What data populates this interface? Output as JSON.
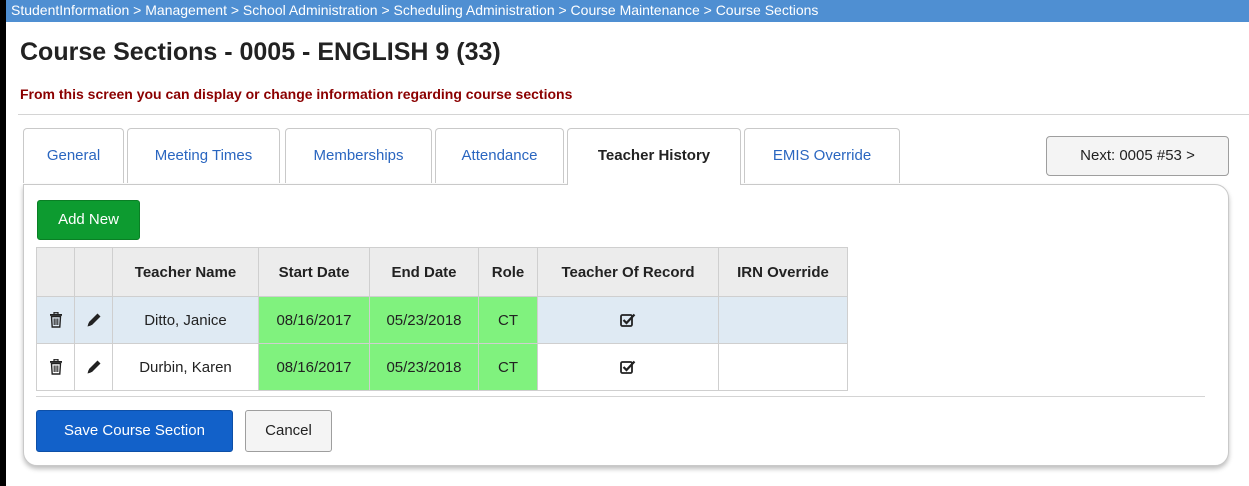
{
  "breadcrumb": "StudentInformation > Management > School Administration > Scheduling Administration > Course Maintenance > Course Sections",
  "page_title": "Course Sections - 0005 - ENGLISH 9 (33)",
  "subtitle": "From this screen you can display or change information regarding course sections",
  "tabs": [
    {
      "label": "General"
    },
    {
      "label": "Meeting Times"
    },
    {
      "label": "Memberships"
    },
    {
      "label": "Attendance"
    },
    {
      "label": "Teacher History"
    },
    {
      "label": "EMIS Override"
    }
  ],
  "active_tab": "Teacher History",
  "next_button": "Next: 0005 #53 >",
  "add_new_button": "Add New",
  "table": {
    "headers": [
      "Teacher Name",
      "Start Date",
      "End Date",
      "Role",
      "Teacher Of Record",
      "IRN Override"
    ],
    "rows": [
      {
        "teacher_name": "Ditto, Janice",
        "start_date": "08/16/2017",
        "end_date": "05/23/2018",
        "role": "CT",
        "teacher_of_record": true,
        "irn_override": ""
      },
      {
        "teacher_name": "Durbin, Karen",
        "start_date": "08/16/2017",
        "end_date": "05/23/2018",
        "role": "CT",
        "teacher_of_record": true,
        "irn_override": ""
      }
    ]
  },
  "save_button": "Save Course Section",
  "cancel_button": "Cancel",
  "colors": {
    "breadcrumb_bar": "#4f8fd2",
    "subtitle_text": "#8b0000",
    "add_button": "#0d9b30",
    "save_button": "#1261c9",
    "highlight_cells": "#80f27e",
    "selected_row": "#dfeaf3"
  },
  "icons": {
    "delete": "trash-icon",
    "edit": "pencil-icon",
    "checked": "checked-box-icon"
  }
}
